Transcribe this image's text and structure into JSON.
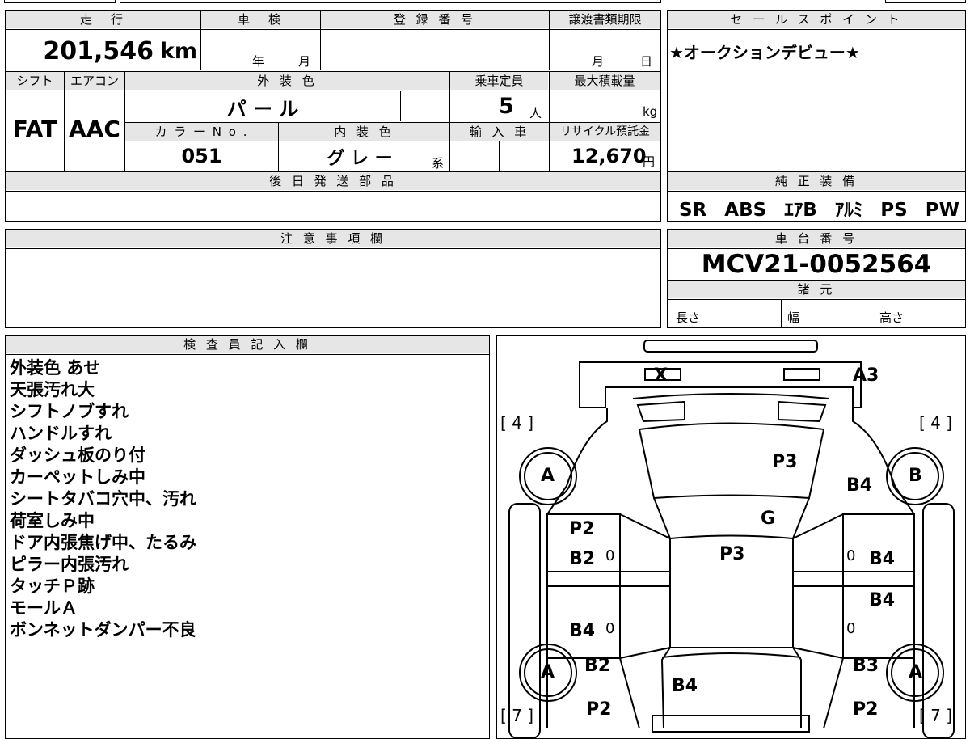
{
  "header": {
    "mileage_label": "走　行",
    "shaken_label": "車　検",
    "reg_no_label": "登 録 番 号",
    "transfer_label": "譲渡書類期限",
    "sales_point_label": "セ ー ル ス ポ イ ン ト"
  },
  "mileage": {
    "value": "201,546",
    "unit": "km"
  },
  "shaken": {
    "year_unit": "年",
    "month_unit": "月"
  },
  "transfer": {
    "month_unit": "月",
    "day_unit": "日"
  },
  "sales_point": {
    "text": "★オークションデビュー★"
  },
  "row2": {
    "shift_label": "シフト",
    "aircon_label": "エアコン",
    "exterior_color_label": "外 装 色",
    "capacity_label": "乗車定員",
    "max_load_label": "最大積載量"
  },
  "shift": "FAT",
  "aircon": "AAC",
  "exterior_color": "パ ー ル",
  "capacity": {
    "value": "5",
    "unit": "人"
  },
  "max_load": {
    "unit": "kg"
  },
  "row3": {
    "color_no_label": "カ ラ ー N o .",
    "interior_color_label": "内 装 色",
    "import_label": "輸 入 車",
    "recycle_label": "リサイクル預託金"
  },
  "color_no": "051",
  "interior_color": {
    "value": "グ レ ー",
    "suffix": "系"
  },
  "recycle": {
    "value": "12,670",
    "unit": "円"
  },
  "later_parts_label": "後 日 発 送 部 品",
  "genuine_equipment": {
    "label": "純 正 装 備",
    "items": [
      "SR",
      "ABS",
      "ｴｱB",
      "ｱﾙﾐ",
      "PS",
      "PW"
    ]
  },
  "notes_label": "注 意 事 項 欄",
  "chassis": {
    "label": "車 台 番 号",
    "value": "MCV21-0052564"
  },
  "specs": {
    "label": "諸 元",
    "length": "長さ",
    "width": "幅",
    "height": "高さ"
  },
  "inspector": {
    "label": "検 査 員 記 入 欄",
    "lines": [
      "外装色 あせ",
      "天張汚れ大",
      "シフトノブすれ",
      "ハンドルすれ",
      "ダッシュ板のり付",
      "カーペットしみ中",
      "シートタバコ穴中、汚れ",
      "荷室しみ中",
      "ドア内張焦げ中、たるみ",
      "ピラー内張汚れ",
      "タッチＰ跡",
      "モールＡ",
      "ボンネットダンパー不良"
    ]
  },
  "diagram": {
    "marks": {
      "trunk_x": "X",
      "rear_a3": "A3",
      "left_rear_tire": "[ 4 ]",
      "right_rear_tire": "[ 4 ]",
      "left_front_tire": "[ 7 ]",
      "right_front_tire": "[ 7 ]",
      "left_rear_wheel": "A",
      "right_rear_wheel": "B",
      "left_front_wheel": "A",
      "right_front_wheel": "A",
      "rear_glass": "P3",
      "right_rear_quarter": "B4",
      "roof_g": "G",
      "roof": "P3",
      "left_rear_door_top": "P2",
      "left_rear_door": "B2",
      "right_rear_door": "B4",
      "right_front_door": "B4",
      "left_front_door": "B4",
      "left_front_fender": "B2",
      "right_front_fender": "B3",
      "hood": "B4",
      "left_front_corner": "P2",
      "right_front_corner": "P2",
      "zero1": "0",
      "zero2": "0",
      "zero3": "0",
      "zero4": "0"
    }
  }
}
